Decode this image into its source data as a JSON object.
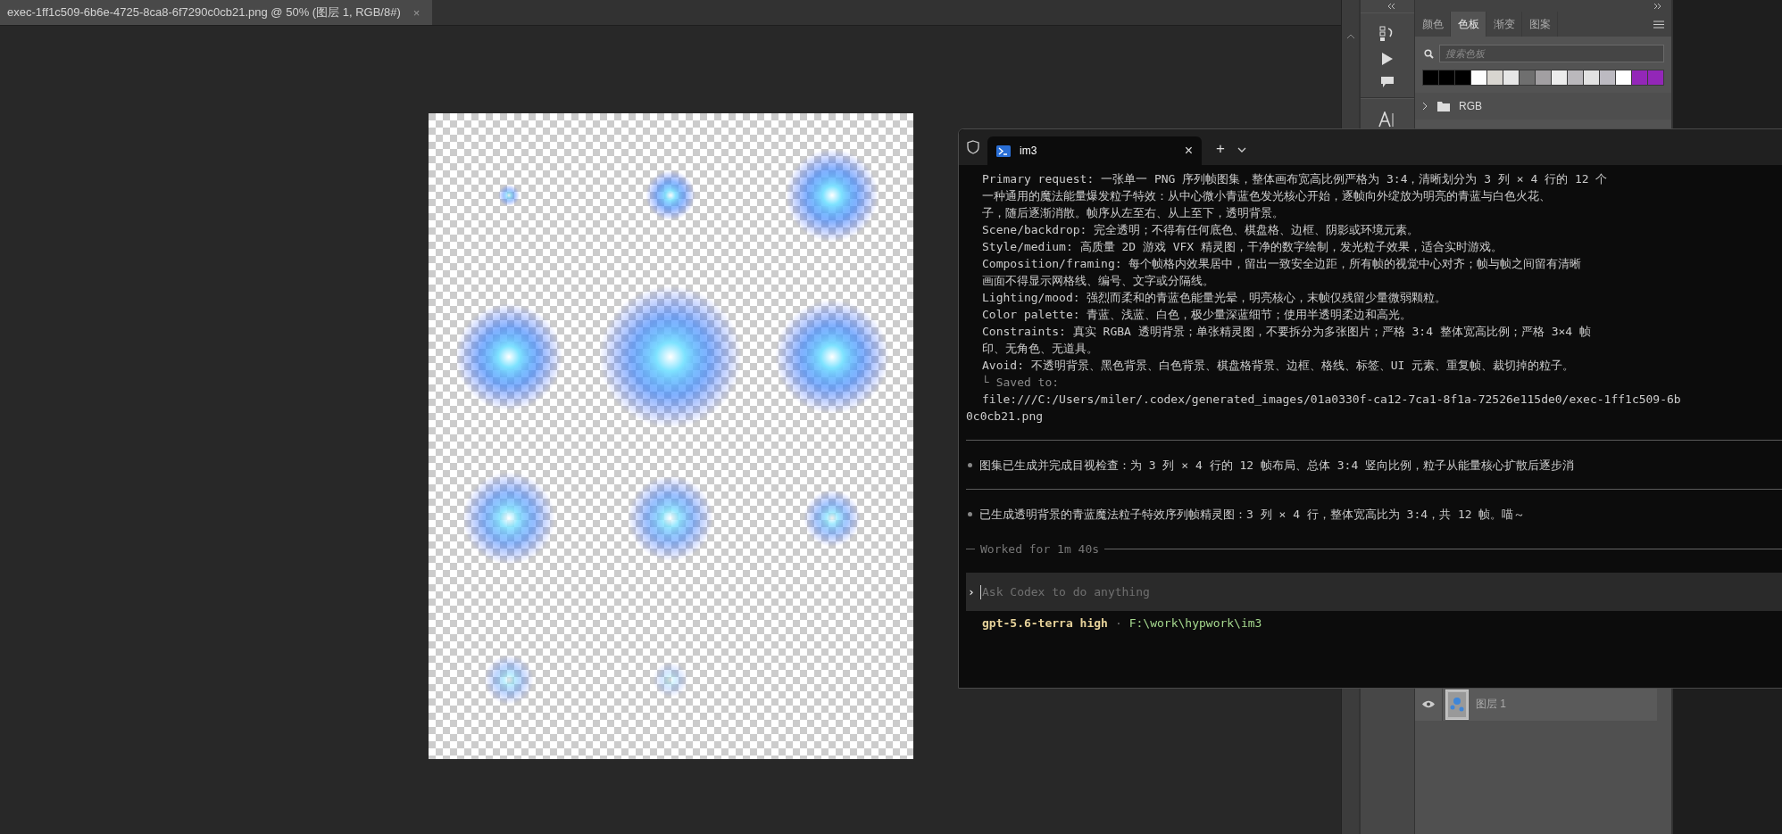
{
  "document_tab": {
    "title": "exec-1ff1c509-6b6e-4725-8ca8-6f7290c0cb21.png @ 50% (图层 1, RGB/8#)",
    "close": "×"
  },
  "panel_dock": {
    "tabs": [
      {
        "label": "颜色",
        "selected": false
      },
      {
        "label": "色板",
        "selected": true
      },
      {
        "label": "渐变",
        "selected": false
      },
      {
        "label": "图案",
        "selected": false
      }
    ],
    "search": {
      "placeholder": "搜索色板"
    },
    "swatches": [
      {
        "color": "#000000"
      },
      {
        "color": "#000000"
      },
      {
        "color": "#000000"
      },
      {
        "color": "#fdfdfd"
      },
      {
        "color": "#d8d5d0"
      },
      {
        "color": "#e6e6e6"
      },
      {
        "color": "#6f6f6f"
      },
      {
        "color": "#a29fa2"
      },
      {
        "color": "#ececec"
      },
      {
        "color": "#bab8bc"
      },
      {
        "color": "#e2e2e2"
      },
      {
        "color": "#bcbac1"
      },
      {
        "color": "#ffffff"
      },
      {
        "color": "#9327b8"
      },
      {
        "color": "#9327b8"
      }
    ],
    "groups": [
      {
        "name": "RGB",
        "expanded": false
      }
    ]
  },
  "layers": [
    {
      "name": "图层 1",
      "visible": true
    }
  ],
  "terminal": {
    "tab_title": "im3",
    "close": "×",
    "new_tab": "+",
    "output": [
      {
        "kind": "line",
        "text": "Primary request: 一张单一 PNG 序列帧图集，整体画布宽高比例严格为 3:4，清晰划分为 3 列 × 4 行的 12 个"
      },
      {
        "kind": "line",
        "text": "一种通用的魔法能量爆发粒子特效：从中心微小青蓝色发光核心开始，逐帧向外绽放为明亮的青蓝与白色火花、"
      },
      {
        "kind": "line",
        "text": "子，随后逐渐消散。帧序从左至右、从上至下，透明背景。"
      },
      {
        "kind": "line",
        "text": "Scene/backdrop: 完全透明；不得有任何底色、棋盘格、边框、阴影或环境元素。"
      },
      {
        "kind": "line",
        "text": "Style/medium: 高质量 2D 游戏 VFX 精灵图，干净的数字绘制，发光粒子效果，适合实时游戏。"
      },
      {
        "kind": "line",
        "text": "Composition/framing: 每个帧格内效果居中，留出一致安全边距，所有帧的视觉中心对齐；帧与帧之间留有清晰"
      },
      {
        "kind": "line",
        "text": "画面不得显示网格线、编号、文字或分隔线。"
      },
      {
        "kind": "line",
        "text": "Lighting/mood: 强烈而柔和的青蓝色能量光晕，明亮核心，末帧仅残留少量微弱颗粒。"
      },
      {
        "kind": "line",
        "text": "Color palette: 青蓝、浅蓝、白色，极少量深蓝细节；使用半透明柔边和高光。"
      },
      {
        "kind": "line",
        "text": "Constraints: 真实 RGBA 透明背景；单张精灵图，不要拆分为多张图片；严格 3:4 整体宽高比例；严格 3×4 帧"
      },
      {
        "kind": "line",
        "text": "印、无角色、无道具。"
      },
      {
        "kind": "line",
        "text": "Avoid: 不透明背景、黑色背景、白色背景、棋盘格背景、边框、格线、标签、UI 元素、重复帧、裁切掉的粒子。"
      },
      {
        "kind": "dim",
        "text": "└ Saved to:"
      },
      {
        "kind": "line",
        "text": "file:///C:/Users/miler/.codex/generated_images/01a0330f-ca12-7ca1-8f1a-72526e115de0/exec-1ff1c509-6b"
      },
      {
        "kind": "flush",
        "text": "0c0cb21.png"
      },
      {
        "kind": "rule"
      },
      {
        "kind": "bullet",
        "text": "图集已生成并完成目视检查：为 3 列 × 4 行的 12 帧布局、总体 3:4 竖向比例，粒子从能量核心扩散后逐步消"
      },
      {
        "kind": "rule"
      },
      {
        "kind": "bullet",
        "text": "已生成透明背景的青蓝魔法粒子特效序列帧精灵图：3 列 × 4 行，整体宽高比为 3:4，共 12 帧。喵～"
      },
      {
        "kind": "worked",
        "text": "Worked for 1m 40s"
      }
    ],
    "prompt": {
      "marker": "›",
      "placeholder": "Ask Codex to do anything"
    },
    "status": {
      "model": "gpt-5.6-terra high",
      "separator": "·",
      "path": "F:\\work\\hypwork\\im3"
    }
  }
}
